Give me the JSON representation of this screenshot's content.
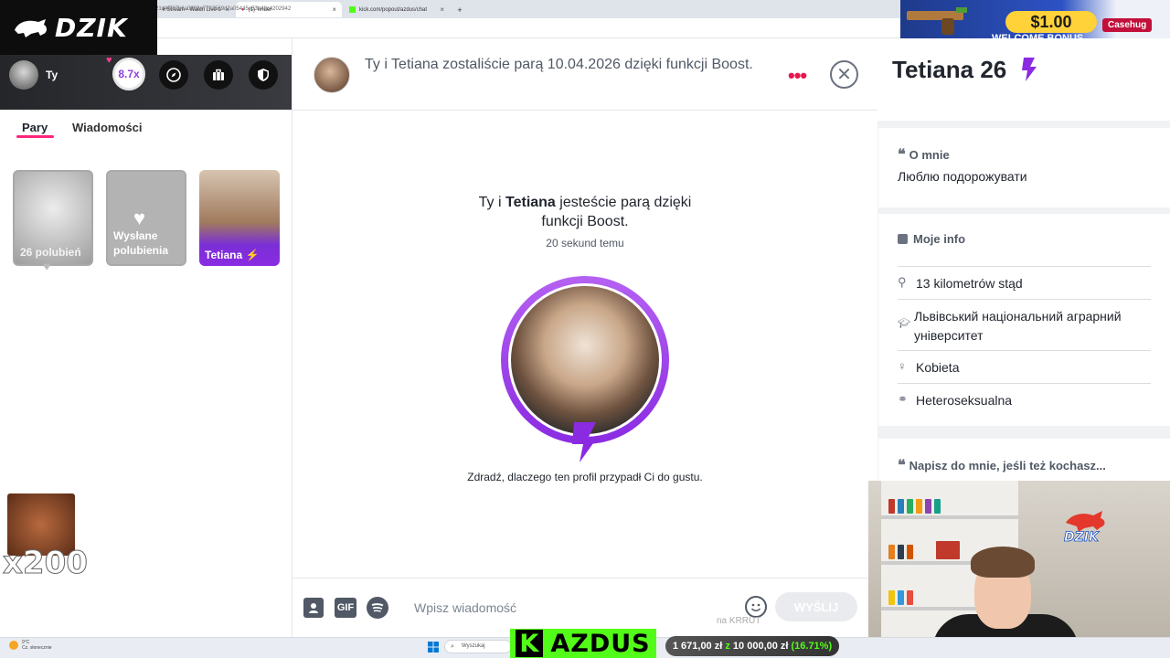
{
  "browser": {
    "tabs": [
      {
        "label": "k Stream - Watch Live o",
        "active": false
      },
      {
        "label": "(1) Tinder",
        "active": true
      },
      {
        "label": "kick.com/popout/azdus/chat",
        "active": false
      }
    ],
    "new_tab": "+",
    "url": "21d4f787b6a0902e7703569d2a05445e53e49c4202942"
  },
  "overlay": {
    "brand_logo": "DZIK",
    "ad_price": "$1.00",
    "ad_subtitle": "WELCOME BONUS",
    "ad_brand": "Casehug",
    "emote_multiplier": "x200"
  },
  "sidebar": {
    "user_label": "Ty",
    "boost_value": "8.7x",
    "icons": [
      "compass-icon",
      "briefcase-icon",
      "shield-icon"
    ],
    "tabs": [
      {
        "label": "Pary",
        "active": true
      },
      {
        "label": "Wiadomości",
        "active": false
      }
    ],
    "cards": [
      {
        "label": "26 polubień"
      },
      {
        "label": "Wysłane polubienia"
      },
      {
        "label": "Tetiana"
      }
    ]
  },
  "chat": {
    "header_text": "Ty i Tetiana zostaliście parą 10.04.2026 dzięki funkcji Boost.",
    "match_prefix": "Ty i ",
    "match_name": "Tetiana",
    "match_suffix": " jesteście parą dzięki funkcji Boost.",
    "match_time": "20 sekund temu",
    "prompt": "Zdradź, dlaczego ten profil przypadł Ci do gustu.",
    "gif_label": "GIF",
    "input_placeholder": "Wpisz wiadomość",
    "send_label": "WYŚLIJ",
    "watermark": "na KRRUT"
  },
  "profile": {
    "name": "Tetiana 26",
    "about_title": "O mnie",
    "about_text": "Люблю подорожувати",
    "info_title": "Moje info",
    "info_rows": [
      {
        "icon": "location-pin-icon",
        "text": "13 kilometrów stąd"
      },
      {
        "icon": "school-icon",
        "text": "Львівський національний аграрний університет"
      },
      {
        "icon": "person-icon",
        "text": "Kobieta"
      },
      {
        "icon": "orientation-icon",
        "text": "Heteroseksualna"
      }
    ],
    "write_title": "Napisz do mnie, jeśli też kochasz..."
  },
  "taskbar": {
    "weather_temp": "9°C",
    "weather_desc": "Cz. słonecznie",
    "search_placeholder": "Wyszukaj",
    "kick_channel": "AZDUS",
    "bet_left": "1 671,00 zł",
    "bet_sep": "z",
    "bet_right": "10 000,00 zł",
    "bet_pct": "(16.71%)"
  },
  "colors": {
    "brand_pink": "#fd267a",
    "boost_purple": "#8a2be2",
    "kick_green": "#53fc18"
  }
}
